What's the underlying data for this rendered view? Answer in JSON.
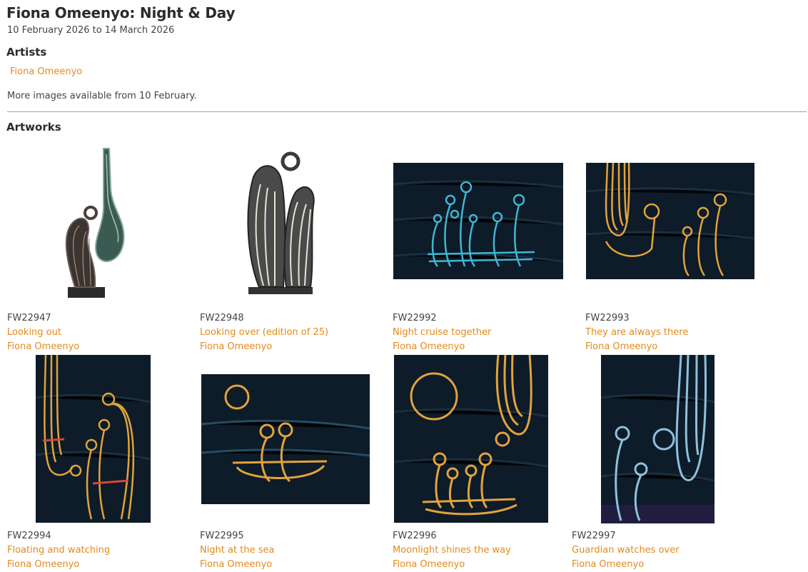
{
  "page": {
    "title": "Fiona Omeenyo: Night & Day",
    "dates": "10 February 2026 to 14 March 2026",
    "artists_heading": "Artists",
    "artist_link": "Fiona Omeenyo",
    "note": "More images available from 10 February.",
    "artworks_heading": "Artworks"
  },
  "artworks": [
    {
      "code": "FW22947",
      "title": "Looking out",
      "artist": "Fiona Omeenyo"
    },
    {
      "code": "FW22948",
      "title": "Looking over (edition of 25)",
      "artist": "Fiona Omeenyo"
    },
    {
      "code": "FW22992",
      "title": "Night cruise together",
      "artist": "Fiona Omeenyo"
    },
    {
      "code": "FW22993",
      "title": "They are always there",
      "artist": "Fiona Omeenyo"
    },
    {
      "code": "FW22994",
      "title": "Floating and watching",
      "artist": "Fiona Omeenyo"
    },
    {
      "code": "FW22995",
      "title": "Night at the sea",
      "artist": "Fiona Omeenyo"
    },
    {
      "code": "FW22996",
      "title": "Moonlight shines the way",
      "artist": "Fiona Omeenyo"
    },
    {
      "code": "FW22997",
      "title": "Guardian watches over",
      "artist": "Fiona Omeenyo"
    }
  ],
  "colors": {
    "link": "#e38a1c",
    "painting_bg": "#0d1a27"
  }
}
